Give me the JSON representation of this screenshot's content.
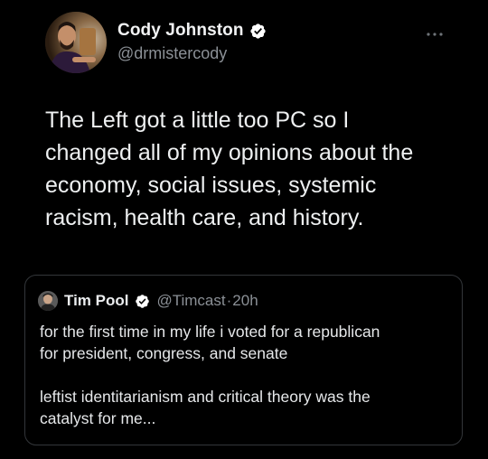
{
  "author": {
    "display_name": "Cody Johnston",
    "handle": "@drmistercody",
    "verified": true
  },
  "tweet": {
    "text": "The Left got a little too PC so I\nchanged all of my opinions about the\neconomy, social issues, systemic\nracism, health care, and history."
  },
  "quoted_tweet": {
    "author": {
      "display_name": "Tim Pool",
      "handle": "@Timcast",
      "verified": true
    },
    "separator": "·",
    "time": "20h",
    "paragraphs": [
      "for the first time in my life i voted for a republican\nfor president, congress, and senate",
      "leftist identitarianism and critical theory was the\ncatalyst for me..."
    ]
  },
  "icons": {
    "verified": "verified-badge-icon",
    "more": "more-horizontal-icon"
  },
  "colors": {
    "background": "#000000",
    "primary_text": "#e7e9ea",
    "secondary_text": "#8b9096",
    "card_border": "#33363a"
  }
}
